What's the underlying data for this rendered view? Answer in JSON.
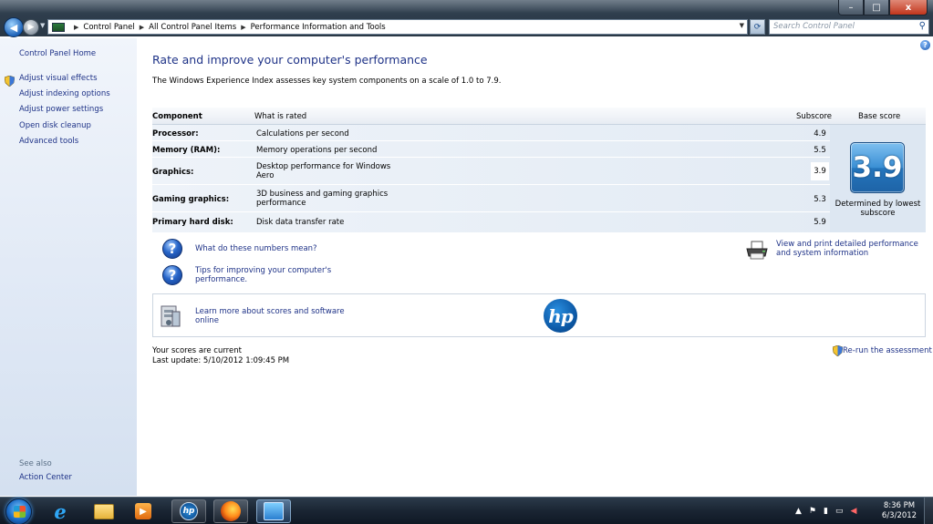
{
  "window": {
    "controls": {
      "minimize": "–",
      "maximize": "□",
      "close": "x"
    }
  },
  "address_bar": {
    "crumbs": [
      "Control Panel",
      "All Control Panel Items",
      "Performance Information and Tools"
    ],
    "search_placeholder": "Search Control Panel"
  },
  "left_pane": {
    "home": "Control Panel Home",
    "links": [
      "Adjust visual effects",
      "Adjust indexing options",
      "Adjust power settings",
      "Open disk cleanup",
      "Advanced tools"
    ],
    "see_also_label": "See also",
    "see_also_links": [
      "Action Center"
    ]
  },
  "main": {
    "title": "Rate and improve your computer's performance",
    "intro": "The Windows Experience Index assesses key system components on a scale of 1.0 to 7.9.",
    "table": {
      "headers": {
        "component": "Component",
        "what": "What is rated",
        "subscore": "Subscore",
        "base": "Base score"
      },
      "rows": [
        {
          "component": "Processor:",
          "what": "Calculations per second",
          "subscore": "4.9"
        },
        {
          "component": "Memory (RAM):",
          "what": "Memory operations per second",
          "subscore": "5.5"
        },
        {
          "component": "Graphics:",
          "what": "Desktop performance for Windows Aero",
          "subscore": "3.9"
        },
        {
          "component": "Gaming graphics:",
          "what": "3D business and gaming graphics performance",
          "subscore": "5.3"
        },
        {
          "component": "Primary hard disk:",
          "what": "Disk data transfer rate",
          "subscore": "5.9"
        }
      ],
      "base_score": "3.9",
      "base_caption": "Determined by lowest subscore"
    },
    "help_links": [
      "What do these numbers mean?",
      "Tips for improving your computer's performance."
    ],
    "print_link": "View and print detailed performance and system information",
    "promo_link": "Learn more about scores and software online",
    "promo_logo": "hp",
    "status": {
      "current": "Your scores are current",
      "last_update": "Last update: 5/10/2012 1:09:45 PM"
    },
    "rerun": "Re-run the assessment"
  },
  "taskbar": {
    "time": "8:36 PM",
    "date": "6/3/2012"
  },
  "colors": {
    "link": "#1e3287",
    "badge_blue": "#2576bd",
    "table_bg": "#e3ebf4"
  }
}
